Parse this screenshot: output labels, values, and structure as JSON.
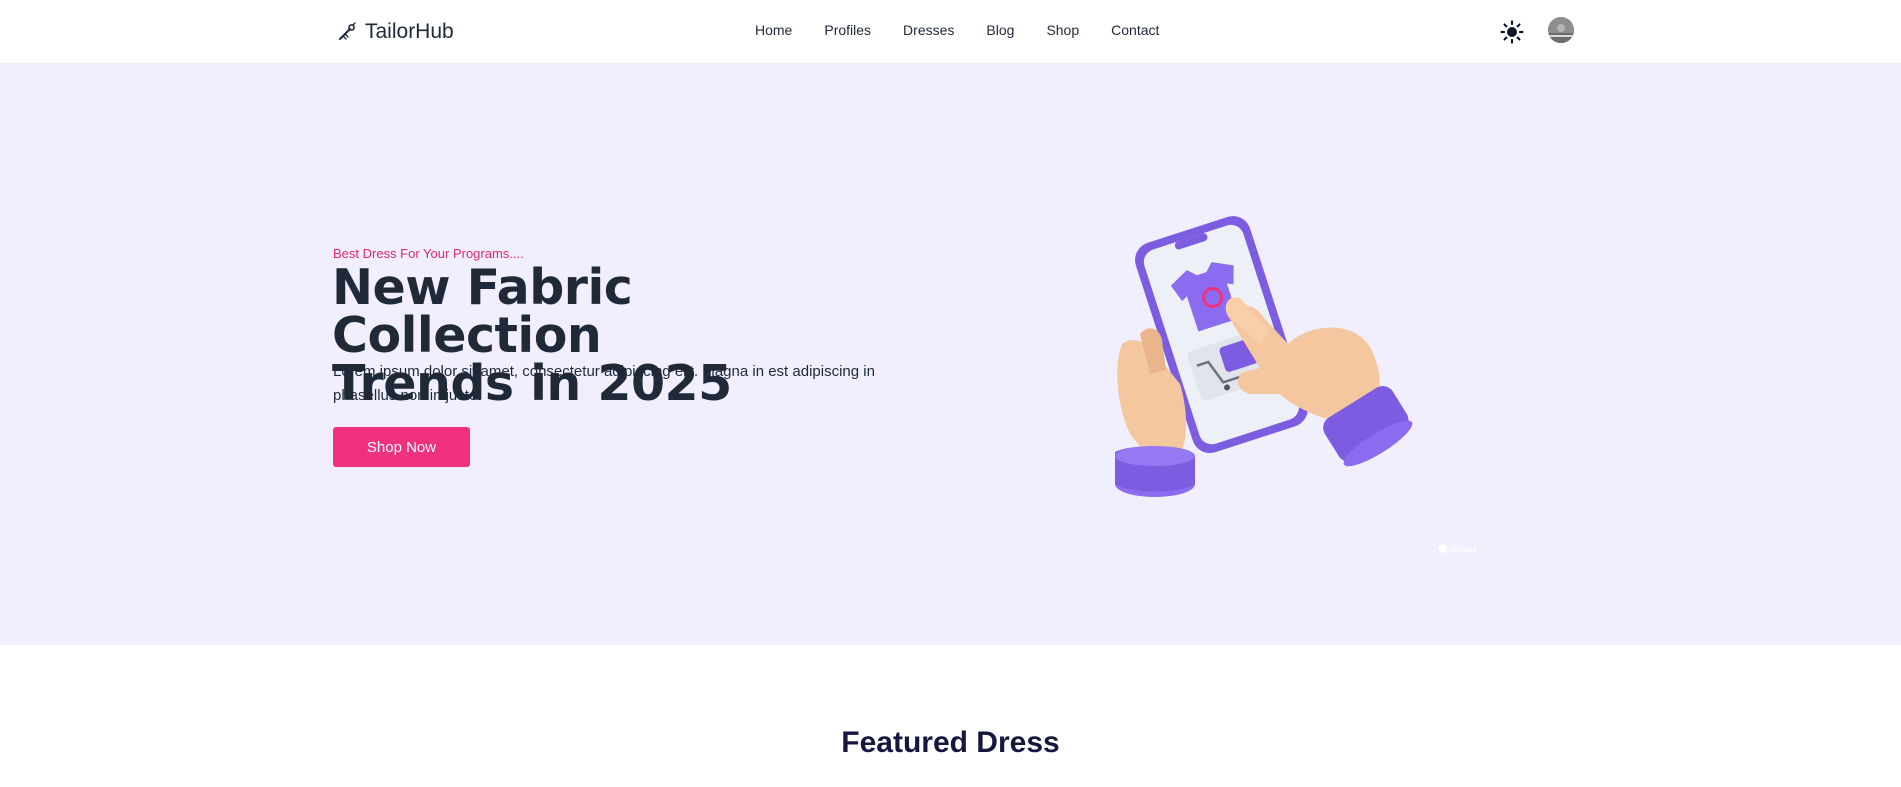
{
  "brand": {
    "name": "TailorHub",
    "icon": "needle-thread-icon"
  },
  "nav": {
    "links": [
      "Home",
      "Profiles",
      "Dresses",
      "Blog",
      "Shop",
      "Contact"
    ]
  },
  "header_actions": {
    "theme_icon": "sun-icon",
    "avatar_icon": "user-avatar"
  },
  "hero": {
    "tagline": "Best Dress For Your Programs....",
    "title_line1": "New Fabric Collection",
    "title_line2": "Trends in 2025",
    "description": "Lorem ipsum dolor sit amet, consectetur adipiscing elit. Magna in est adipiscing in phasellus non in justo.",
    "cta_label": "Shop Now",
    "watermark": "ikiraaz",
    "illustration": "hands-holding-phone-shopping-illustration"
  },
  "featured": {
    "title": "Featured Dress"
  },
  "colors": {
    "accent": "#f0317f",
    "tagline": "#db2777",
    "hero_bg": "#f1effd",
    "heading": "#1f2937",
    "section_title": "#16163f",
    "illustration_purple": "#7c5ce0"
  }
}
